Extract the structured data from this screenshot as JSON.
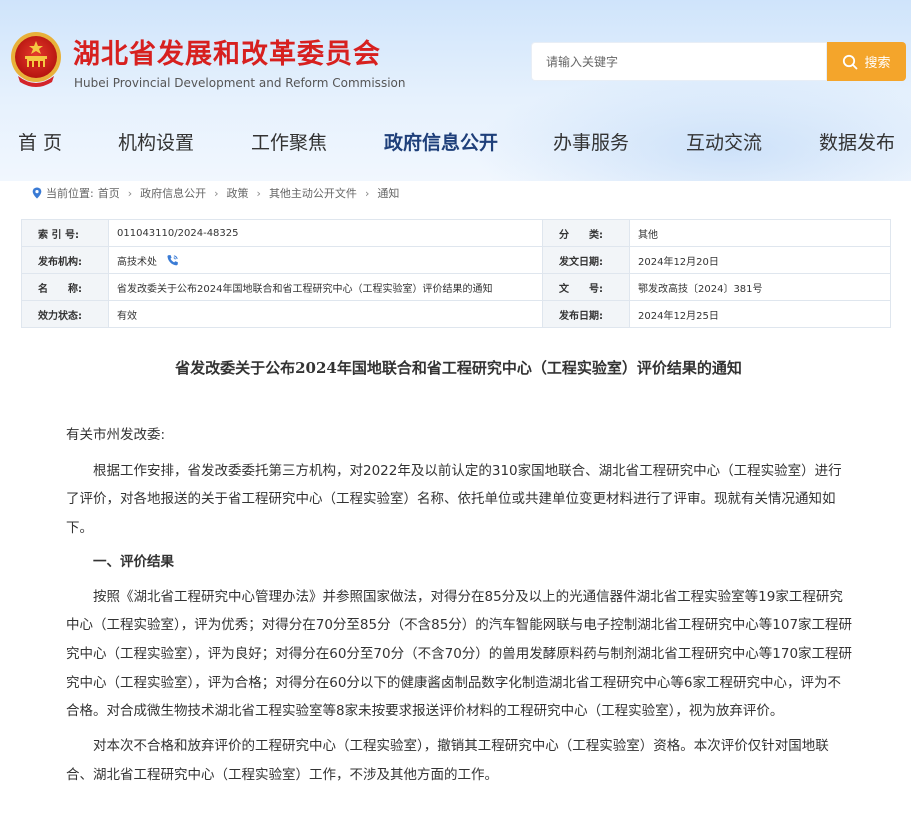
{
  "header": {
    "title_cn": "湖北省发展和改革委员会",
    "title_en": "Hubei Provincial Development and Reform Commission",
    "search_placeholder": "请输入关键字",
    "search_button": "搜索"
  },
  "nav": [
    {
      "label": "首 页"
    },
    {
      "label": "机构设置"
    },
    {
      "label": "工作聚焦"
    },
    {
      "label": "政府信息公开"
    },
    {
      "label": "办事服务"
    },
    {
      "label": "互动交流"
    },
    {
      "label": "数据发布"
    }
  ],
  "breadcrumb": {
    "prefix": "当前位置:",
    "items": [
      "首页",
      "政府信息公开",
      "政策",
      "其他主动公开文件",
      "通知"
    ]
  },
  "meta": {
    "index_label": "索 引 号:",
    "index_value": "011043110/2024-48325",
    "category_label": "分　　类:",
    "category_value": "其他",
    "issuer_label": "发布机构:",
    "issuer_value": "高技术处",
    "issue_date_label": "发文日期:",
    "issue_date_value": "2024年12月20日",
    "name_label": "名　　称:",
    "name_value": "省发改委关于公布2024年国地联合和省工程研究中心（工程实验室）评价结果的通知",
    "docno_label": "文　　号:",
    "docno_value": "鄂发改高技〔2024〕381号",
    "status_label": "效力状态:",
    "status_value": "有效",
    "pub_date_label": "发布日期:",
    "pub_date_value": "2024年12月25日"
  },
  "article": {
    "title": "省发改委关于公布2024年国地联合和省工程研究中心（工程实验室）评价结果的通知",
    "salutation": "有关市州发改委:",
    "para1": "根据工作安排，省发改委委托第三方机构，对2022年及以前认定的310家国地联合、湖北省工程研究中心（工程实验室）进行了评价，对各地报送的关于省工程研究中心（工程实验室）名称、依托单位或共建单位变更材料进行了评审。现就有关情况通知如下。",
    "section1": "一、评价结果",
    "para2": "按照《湖北省工程研究中心管理办法》并参照国家做法，对得分在85分及以上的光通信器件湖北省工程实验室等19家工程研究中心（工程实验室），评为优秀；对得分在70分至85分（不含85分）的汽车智能网联与电子控制湖北省工程研究中心等107家工程研究中心（工程实验室），评为良好；对得分在60分至70分（不含70分）的兽用发酵原料药与制剂湖北省工程研究中心等170家工程研究中心（工程实验室），评为合格；对得分在60分以下的健康酱卤制品数字化制造湖北省工程研究中心等6家工程研究中心，评为不合格。对合成微生物技术湖北省工程实验室等8家未按要求报送评价材料的工程研究中心（工程实验室），视为放弃评价。",
    "para3": "对本次不合格和放弃评价的工程研究中心（工程实验室），撤销其工程研究中心（工程实验室）资格。本次评价仅针对国地联合、湖北省工程研究中心（工程实验室）工作，不涉及其他方面的工作。"
  },
  "colors": {
    "brand_red": "#d7201f",
    "search_orange": "#f4a52b",
    "nav_active": "#1e3f7a"
  }
}
